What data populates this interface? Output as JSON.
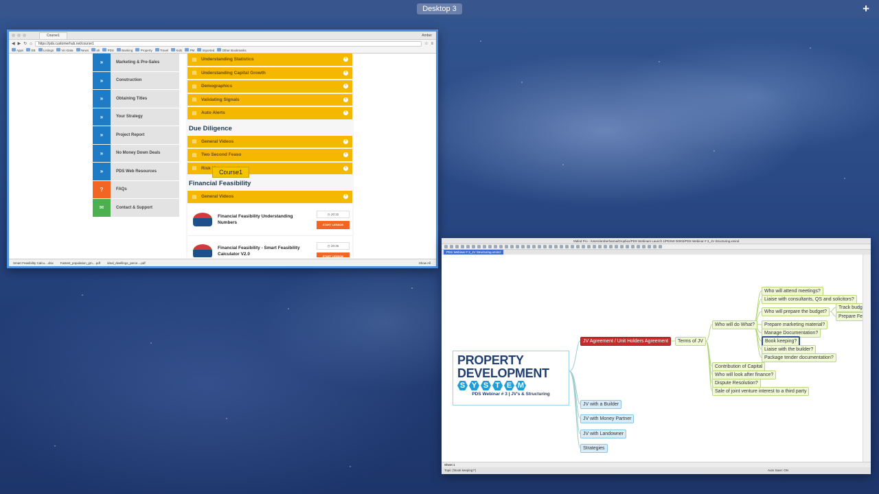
{
  "desktop": {
    "label": "Desktop 3",
    "add_label": "+"
  },
  "browser": {
    "tab_title": "Course1",
    "user_label": "Amber",
    "url": "https://pds.customerhub.net/course1",
    "bookmarks": [
      "Apps",
      "EB",
      "Listings",
      "Vic-Data",
      "News",
      "ah",
      "PDS",
      "Banking",
      "Property",
      "Travel",
      "Kids",
      "PM",
      "Imported",
      "Other Bookmarks"
    ],
    "sidebar_items": [
      {
        "label": "Marketing & Pre-Sales",
        "icon": "double-chevron-right-icon",
        "color": "blue"
      },
      {
        "label": "Construction",
        "icon": "double-chevron-right-icon",
        "color": "blue"
      },
      {
        "label": "Obtaining Titles",
        "icon": "double-chevron-right-icon",
        "color": "blue"
      },
      {
        "label": "Your Strategy",
        "icon": "double-chevron-right-icon",
        "color": "blue"
      },
      {
        "label": "Project Report",
        "icon": "double-chevron-right-icon",
        "color": "blue"
      },
      {
        "label": "No Money Down Deals",
        "icon": "double-chevron-right-icon",
        "color": "blue"
      },
      {
        "label": "PDS Web Resources",
        "icon": "double-chevron-right-icon",
        "color": "blue"
      },
      {
        "label": "FAQs",
        "icon": "question-icon",
        "color": "orange"
      },
      {
        "label": "Contact & Support",
        "icon": "envelope-icon",
        "color": "green"
      }
    ],
    "lessons_top": [
      "Understanding Statistics",
      "Understanding Capital Growth",
      "Demographics",
      "Validating Signals",
      "Auto Alerts"
    ],
    "section_due": "Due Diligence",
    "lessons_due": [
      "General Videos",
      "Two Second Feaso",
      "Risk Management"
    ],
    "section_fin": "Financial Feasibility",
    "lessons_fin": [
      "General Videos"
    ],
    "cards": [
      {
        "title": "Financial Feasibility Understanding Numbers",
        "time": "20:32",
        "button": "START LESSON"
      },
      {
        "title": "Financial Feasibility - Smart Feasibility Calculator V2.0",
        "time": "20:36",
        "button": "START LESSON"
      }
    ],
    "tooltip": "Course1",
    "downloads": [
      "Smart Feasibility Calcu....xlsx",
      "Fastest_population_grn....pdf",
      "ideal_dwellings_perce....pdf"
    ],
    "show_all": "Show All"
  },
  "mindmap": {
    "title": "XMind Pro - /Users/amberhanna/Dropbox/PDS Webinars Launch 1/PDSW 00003/PDS Webinar # 3_JV Structuring.xmind",
    "tab": "PDS Webinar # 3_JV Structuring.xmind",
    "logo": {
      "line1": "PROPERTY",
      "line2": "DEVELOPMENT",
      "system": [
        "S",
        "Y",
        "S",
        "T",
        "E",
        "M"
      ],
      "subtitle": "PDS Webinar # 3 | JV's & Structuring"
    },
    "nodes": {
      "jv_agreement": "JV Agreement / Unit Holders Agreement",
      "terms": "Terms of JV",
      "who_do_what": "Who will do What?",
      "attend": "Who will attend meetings?",
      "liaise_consult": "Liaise with consultants, QS and solicitors?",
      "budget": "Who will prepare the budget?",
      "track_budget": "Track budge",
      "prepare_fea": "Prepare Fea",
      "marketing": "Prepare marketing material?",
      "documentation": "Manage Documentation?",
      "bookkeeping": "Book keeping?",
      "liaise_builder": "Liaise with the builder?",
      "tender": "Package tender documentation?",
      "contribution": "Contribution of Capital",
      "finance": "Who will look after finance?",
      "dispute": "Dispute Resolution?",
      "sale": "Sale of joint venture interest to a third party",
      "builder": "JV with a Builder",
      "money": "JV with Money Partner",
      "landowner": "JV with Landowner",
      "strategies": "Strategies"
    },
    "sheet": "Sheet 1",
    "status": "Topic ('Book keeping?')",
    "autosave": "Auto Save: ON"
  }
}
